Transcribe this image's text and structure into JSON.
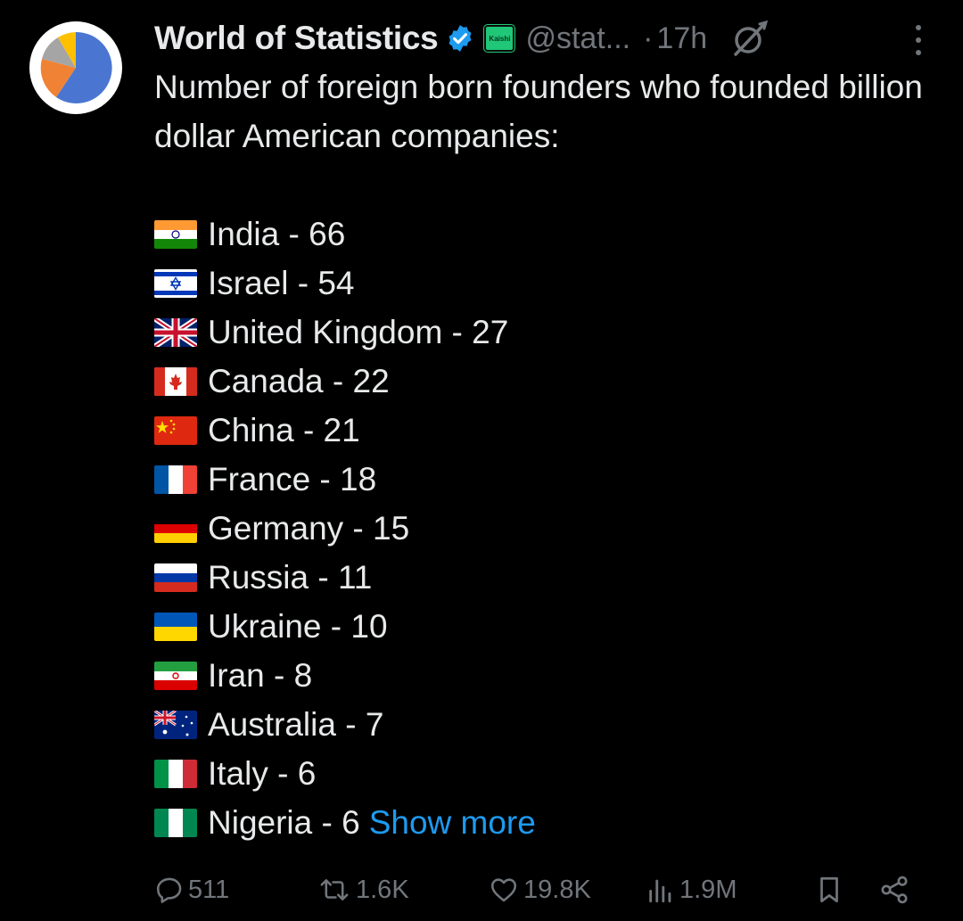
{
  "post": {
    "author": {
      "display_name": "World of Statistics",
      "handle": "@stat...",
      "verified_icon": "verified-badge-icon",
      "affiliation_label": "Kaishi",
      "avatar": "pie-chart-avatar"
    },
    "time_separator": "·",
    "timestamp": "17h",
    "intro_text": "Number of foreign born founders who founded billion dollar American companies:",
    "entries": [
      {
        "flag": "india-flag-icon",
        "text": "India - 66"
      },
      {
        "flag": "israel-flag-icon",
        "text": "Israel - 54"
      },
      {
        "flag": "uk-flag-icon",
        "text": "United Kingdom - 27"
      },
      {
        "flag": "canada-flag-icon",
        "text": "Canada - 22"
      },
      {
        "flag": "china-flag-icon",
        "text": "China - 21"
      },
      {
        "flag": "france-flag-icon",
        "text": "France - 18"
      },
      {
        "flag": "germany-flag-icon",
        "text": "Germany - 15"
      },
      {
        "flag": "russia-flag-icon",
        "text": "Russia - 11"
      },
      {
        "flag": "ukraine-flag-icon",
        "text": "Ukraine - 10"
      },
      {
        "flag": "iran-flag-icon",
        "text": "Iran - 8"
      },
      {
        "flag": "australia-flag-icon",
        "text": "Australia - 7"
      },
      {
        "flag": "italy-flag-icon",
        "text": "Italy - 6"
      },
      {
        "flag": "nigeria-flag-icon",
        "text": "Nigeria - 6"
      }
    ],
    "show_more_label": "Show more"
  },
  "actions": {
    "replies": "511",
    "reposts": "1.6K",
    "likes": "19.8K",
    "views": "1.9M"
  },
  "colors": {
    "background": "#000000",
    "text_primary": "#e7e9ea",
    "text_secondary": "#71767b",
    "link": "#1d9bf0",
    "verified": "#1d9bf0",
    "affiliation": "#1fc776"
  }
}
